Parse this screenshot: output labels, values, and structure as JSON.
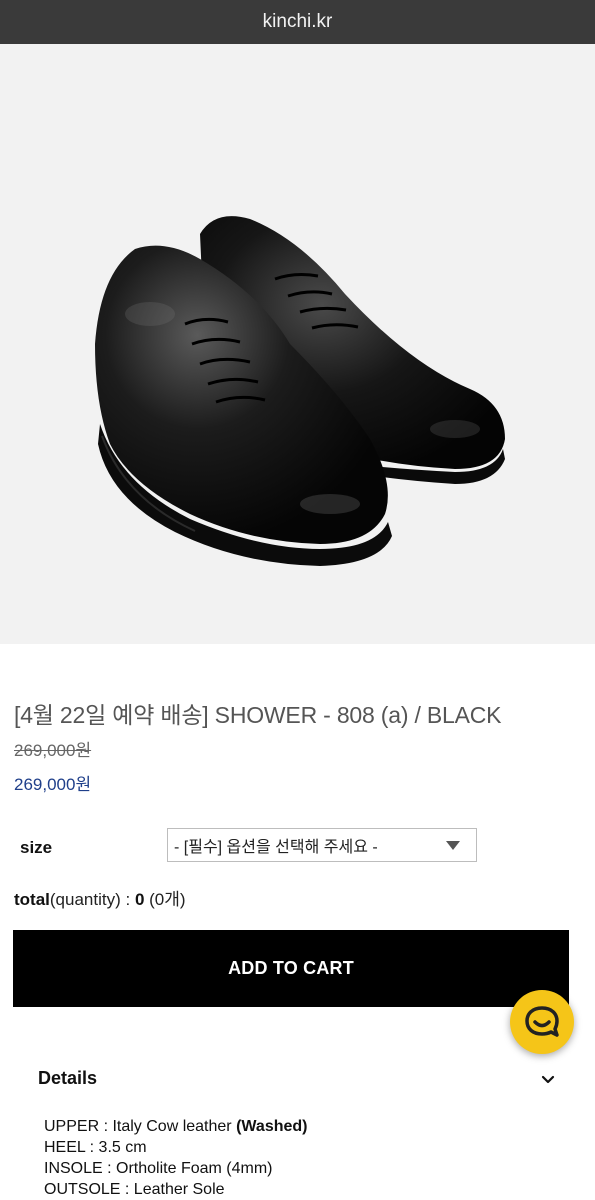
{
  "header": {
    "domain": "kinchi.kr"
  },
  "product": {
    "title": "[4월 22일 예약 배송] SHOWER - 808 (a) / BLACK",
    "original_price": "269,000원",
    "sale_price": "269,000원",
    "image_alt": "black leather derby shoes"
  },
  "options": {
    "size_label": "size",
    "size_select_value": "- [필수] 옵션을 선택해 주세요 -"
  },
  "total": {
    "label": "total",
    "qty_label": "(quantity) : ",
    "amount": "0",
    "count": "(0개)"
  },
  "cart": {
    "button_label": "ADD TO CART"
  },
  "details": {
    "heading": "Details",
    "specs": [
      {
        "label": "UPPER  :  Italy Cow leather ",
        "bold": "(Washed)"
      },
      {
        "label": "HEEL : 3.5 cm",
        "bold": ""
      },
      {
        "label": "INSOLE : Ortholite Foam (4mm)",
        "bold": ""
      },
      {
        "label": "OUTSOLE : Leather Sole",
        "bold": ""
      }
    ]
  },
  "colors": {
    "topbar": "#3a3a3a",
    "accent_price": "#1f3f8a",
    "cart_button": "#000000",
    "chat_button": "#f5c518"
  },
  "icons": {
    "chat": "chat-smile-icon",
    "expand": "chevron-down-icon",
    "select": "caret-down-icon"
  }
}
